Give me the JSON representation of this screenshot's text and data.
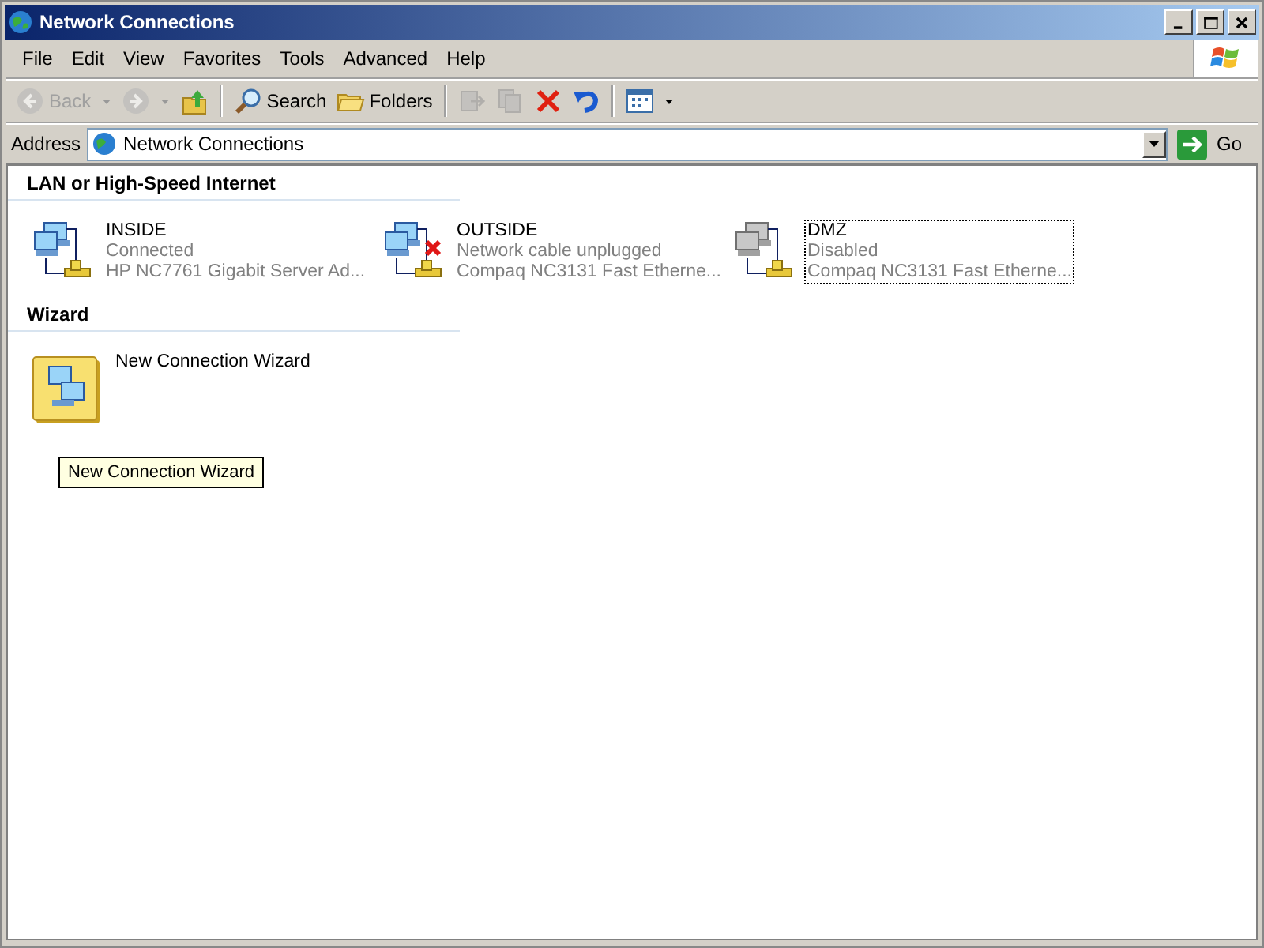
{
  "window": {
    "title": "Network Connections"
  },
  "menu": [
    "File",
    "Edit",
    "View",
    "Favorites",
    "Tools",
    "Advanced",
    "Help"
  ],
  "toolbar": [
    {
      "kind": "back",
      "label": "Back",
      "disabled": true
    },
    {
      "kind": "forward",
      "disabled": true
    },
    {
      "kind": "up",
      "disabled": false
    },
    {
      "kind": "separator"
    },
    {
      "kind": "search",
      "label": "Search",
      "disabled": false
    },
    {
      "kind": "folders",
      "label": "Folders",
      "disabled": false
    },
    {
      "kind": "separator"
    },
    {
      "kind": "move",
      "disabled": true
    },
    {
      "kind": "copy",
      "disabled": true
    },
    {
      "kind": "delete",
      "disabled": false
    },
    {
      "kind": "undo",
      "disabled": false
    },
    {
      "kind": "separator"
    },
    {
      "kind": "views",
      "disabled": false
    }
  ],
  "address": {
    "label": "Address",
    "value": "Network Connections",
    "go": "Go"
  },
  "groups": [
    {
      "title": "LAN or High-Speed Internet",
      "items": [
        {
          "kind": "lan",
          "name": "INSIDE",
          "status": "Connected",
          "device": "HP NC7761 Gigabit Server Ad...",
          "unplugged": false,
          "disabled": false,
          "selected": false
        },
        {
          "kind": "lan",
          "name": "OUTSIDE",
          "status": "Network cable unplugged",
          "device": "Compaq NC3131 Fast Etherne...",
          "unplugged": true,
          "disabled": false,
          "selected": false
        },
        {
          "kind": "lan",
          "name": "DMZ",
          "status": "Disabled",
          "device": "Compaq NC3131 Fast Etherne...",
          "unplugged": false,
          "disabled": true,
          "selected": true
        }
      ]
    },
    {
      "title": "Wizard",
      "items": [
        {
          "kind": "wizard",
          "name": "New Connection Wizard",
          "selected": false
        }
      ]
    }
  ],
  "tooltip": "New Connection Wizard"
}
